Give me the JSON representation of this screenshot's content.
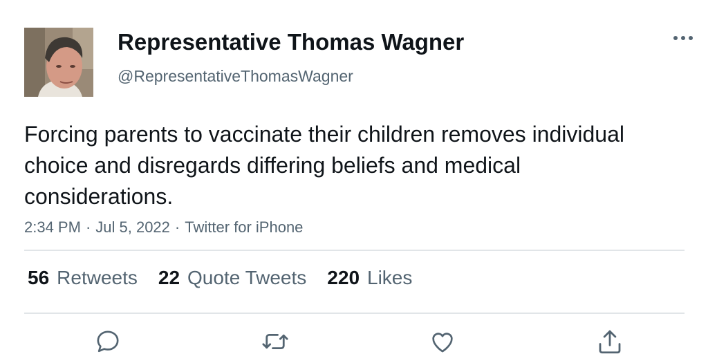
{
  "author": {
    "name": "Representative Thomas Wagner",
    "handle": "@RepresentativeThomasWagner",
    "avatar_icon": "profile-photo"
  },
  "tweet": {
    "text": "Forcing parents to vaccinate their children removes individual choice and disregards differing beliefs and medical considerations.",
    "time": "2:34 PM",
    "date": "Jul 5, 2022",
    "source": "Twitter for iPhone",
    "separator": "·"
  },
  "stats": {
    "retweets": {
      "count": "56",
      "label": "Retweets"
    },
    "quote_tweets": {
      "count": "22",
      "label": "Quote Tweets"
    },
    "likes": {
      "count": "220",
      "label": "Likes"
    }
  },
  "actions": [
    "reply-icon",
    "retweet-icon",
    "like-icon",
    "share-icon"
  ],
  "colors": {
    "text_primary": "#0f1419",
    "text_secondary": "#536471",
    "divider": "#e1e5e8"
  }
}
